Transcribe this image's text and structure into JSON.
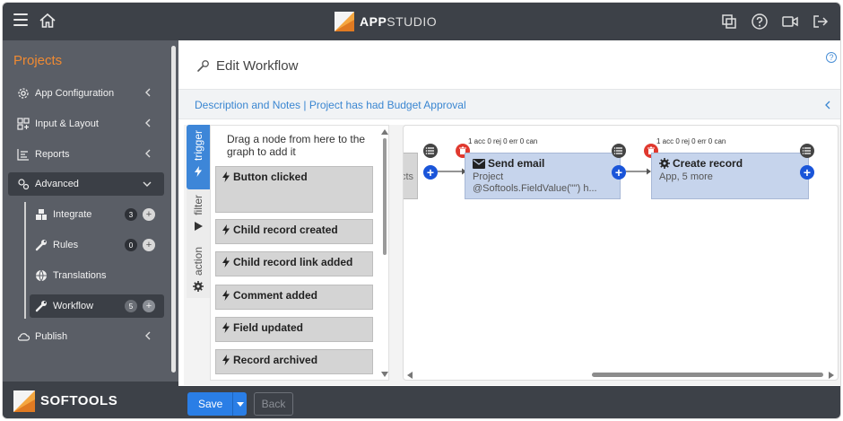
{
  "topbar": {
    "brand_prefix": "APP",
    "brand_suffix": "STUDIO"
  },
  "sidebar": {
    "title": "Projects",
    "items": [
      {
        "label": "App Configuration"
      },
      {
        "label": "Input & Layout"
      },
      {
        "label": "Reports"
      },
      {
        "label": "Advanced"
      },
      {
        "label": "Publish"
      }
    ],
    "subitems": [
      {
        "label": "Integrate",
        "badge": "3"
      },
      {
        "label": "Rules",
        "badge": "0"
      },
      {
        "label": "Translations"
      },
      {
        "label": "Workflow",
        "badge": "5"
      }
    ],
    "footer_brand": "SOFTOOLS"
  },
  "main": {
    "title": "Edit Workflow",
    "help_glyph": "?",
    "description": "Description and Notes | Project has had Budget Approval",
    "tabs": [
      "trigger",
      "filter",
      "action"
    ],
    "palette_hint": "Drag a node from here to the graph to add it",
    "nodes": [
      "Button clicked",
      "Child record created",
      "Child record link added",
      "Comment added",
      "Field updated",
      "Record archived"
    ]
  },
  "graph": {
    "partial_label": "cts",
    "cards": [
      {
        "stats": "1 acc 0 rej 0 err 0 can",
        "title": "Send email",
        "sub1": "Project",
        "sub2": "@Softools.FieldValue(\"\") h..."
      },
      {
        "stats": "1 acc 0 rej 0 err 0 can",
        "title": "Create record",
        "sub1": "App, 5 more",
        "sub2": ""
      }
    ],
    "add_glyph": "+"
  },
  "bottombar": {
    "save_label": "Save",
    "back_label": "Back"
  },
  "colors": {
    "accent": "#2a7ee6",
    "orange": "#f08a32",
    "dark": "#3d4148",
    "card": "#c6d4ec",
    "delete": "#e0392f"
  }
}
